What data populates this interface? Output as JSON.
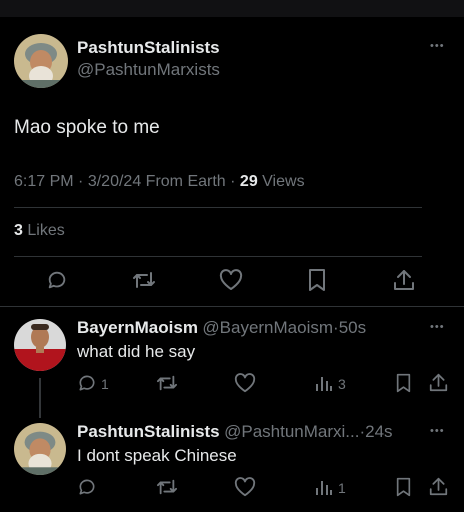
{
  "main_tweet": {
    "author_name": "PashtunStalinists",
    "author_handle": "@PashtunMarxists",
    "text": "Mao spoke to me",
    "time": "6:17 PM",
    "date": "3/20/24",
    "location": "From Earth",
    "separator": "·",
    "views_count": "29",
    "views_label": "Views",
    "likes_count": "3",
    "likes_label": "Likes",
    "more_label": "•••"
  },
  "replies": [
    {
      "author_name": "BayernMaoism",
      "author_handle": "@BayernMaoism",
      "time_ago": "·50s",
      "text": "what did he say",
      "reply_count": "1",
      "views_count": "3",
      "more_label": "•••"
    },
    {
      "author_name": "PashtunStalinists",
      "author_handle": "@PashtunMarxi...",
      "time_ago": "·24s",
      "text": "I dont speak Chinese",
      "views_count": "1",
      "more_label": "•••"
    }
  ],
  "colors": {
    "background": "#000000",
    "text_primary": "#e7e9ea",
    "text_secondary": "#71767b",
    "divider": "#2f3336"
  }
}
